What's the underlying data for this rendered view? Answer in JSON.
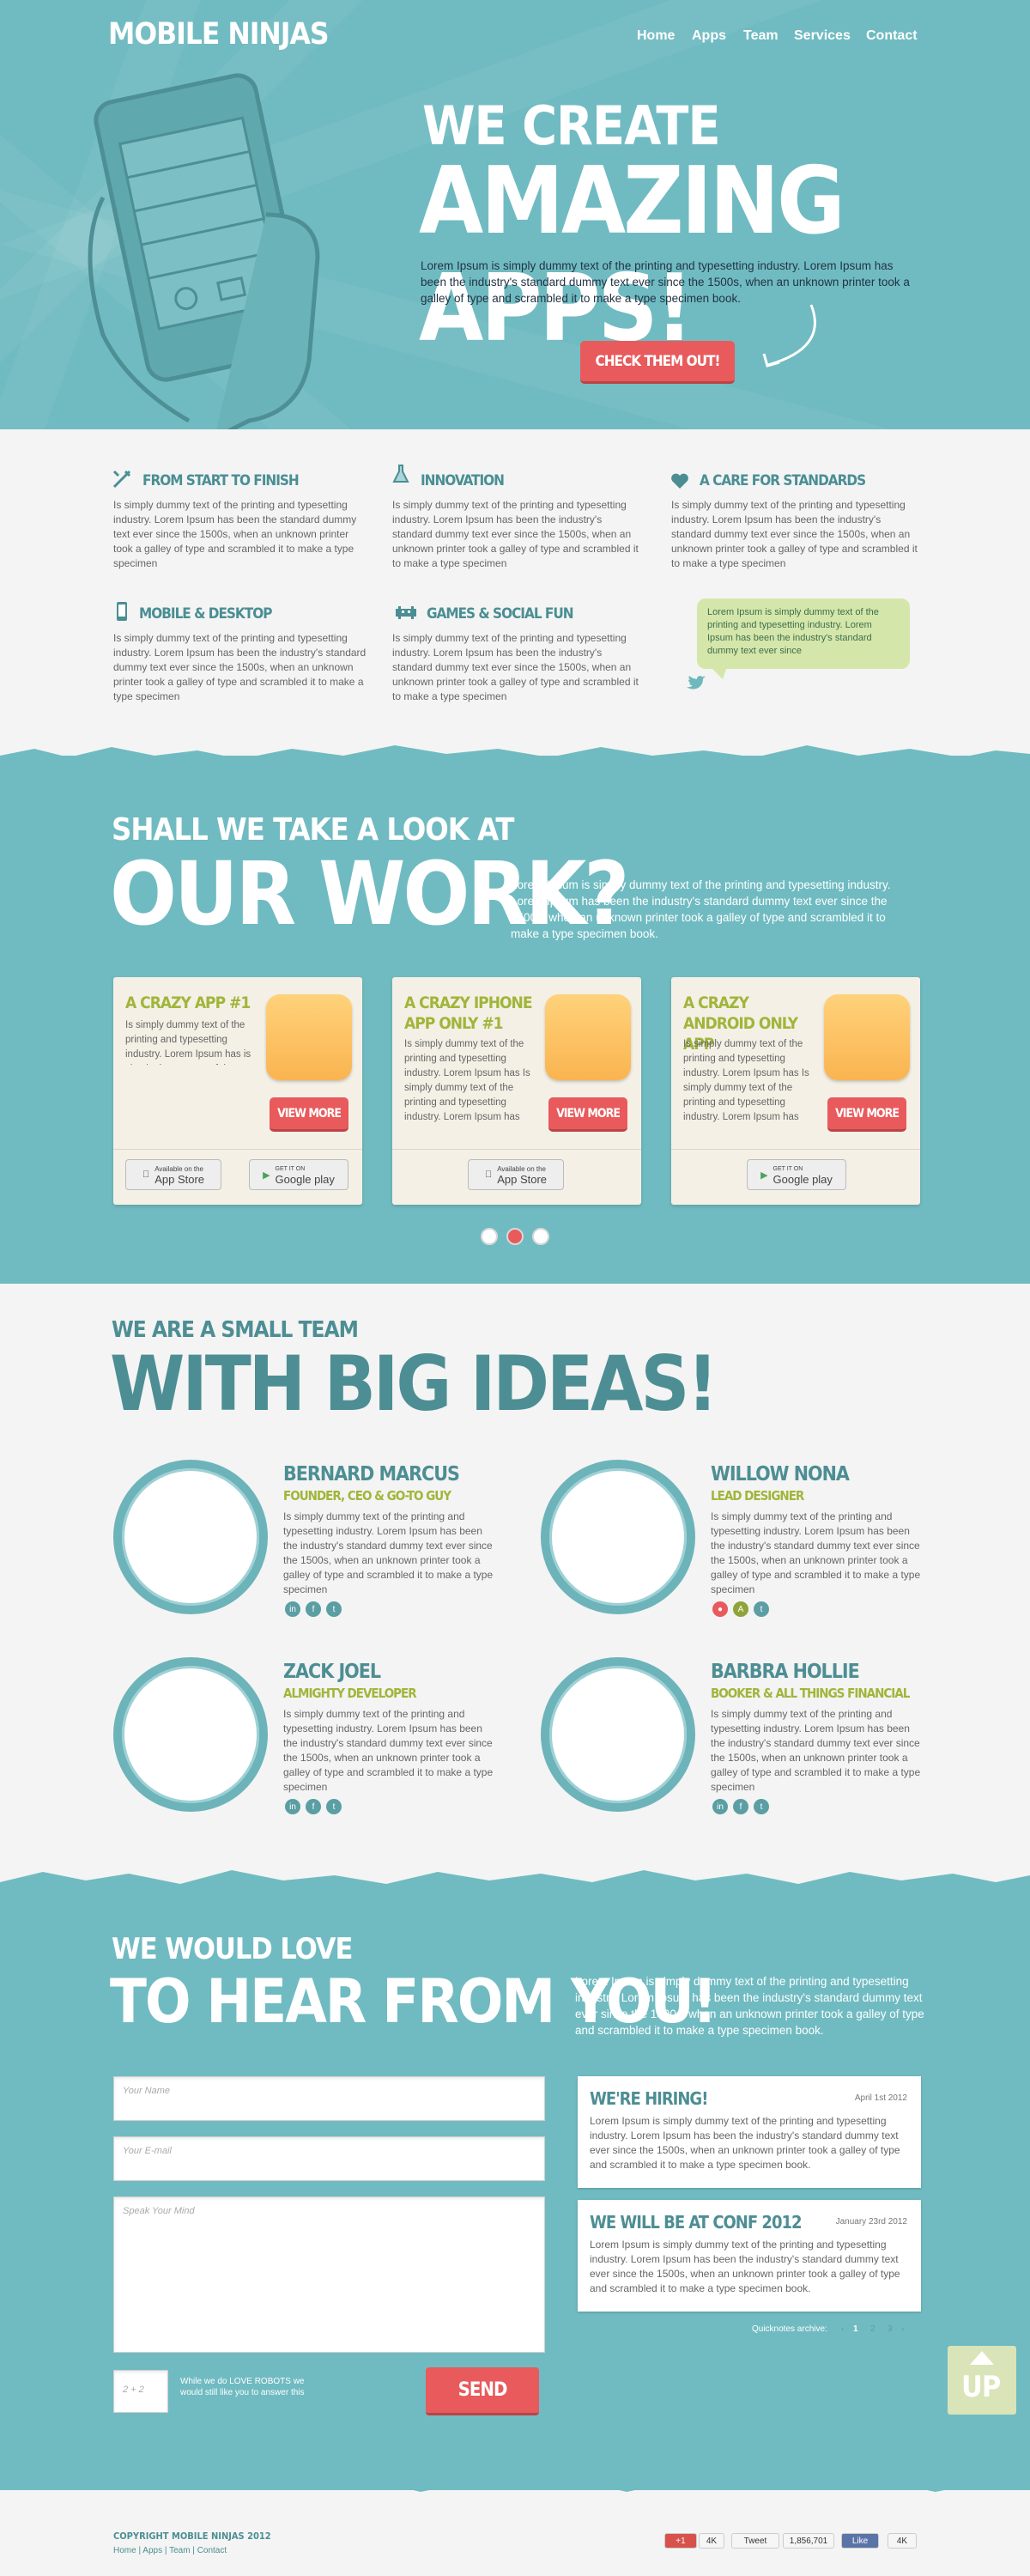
{
  "brand": {
    "name": "MOBILE NINJAS"
  },
  "nav": [
    "Home",
    "Apps",
    "Team",
    "Services",
    "Contact"
  ],
  "hero": {
    "line1": "WE CREATE",
    "line2": "AMAZING APPS!",
    "text": "Lorem Ipsum is simply dummy text of the printing and typesetting industry. Lorem Ipsum has been the industry's standard dummy text ever since the 1500s, when an unknown printer took a galley of type and scrambled it to make a type specimen book.",
    "cta": "CHECK THEM OUT!"
  },
  "features": [
    {
      "title": "FROM START TO FINISH",
      "icon": "tools-icon",
      "text": "Is simply dummy text of the printing and typesetting industry. Lorem Ipsum has been the standard dummy text ever since the 1500s, when an unknown printer took a galley of type and scrambled it to make a type specimen"
    },
    {
      "title": "INNOVATION",
      "icon": "flask-icon",
      "text": "Is simply dummy text of the printing and typesetting industry. Lorem Ipsum has been the industry's standard dummy text ever since the 1500s, when an unknown printer took a galley of type and scrambled it to make a type specimen"
    },
    {
      "title": "A CARE FOR STANDARDS",
      "icon": "heart-icon",
      "text": "Is simply dummy text of the printing and typesetting industry. Lorem Ipsum has been the industry's standard dummy text ever since the 1500s, when an unknown printer took a galley of type and scrambled it to make a type specimen"
    },
    {
      "title": "MOBILE & DESKTOP",
      "icon": "phone-icon",
      "text": "Is simply dummy text of the printing and typesetting industry. Lorem Ipsum has been the industry's standard dummy text ever since the 1500s, when an unknown printer took a galley of type and scrambled it to make a type specimen"
    },
    {
      "title": "GAMES & SOCIAL FUN",
      "icon": "invader-icon",
      "text": "Is simply dummy text of the printing and typesetting industry. Lorem Ipsum has been the industry's standard dummy text ever since the 1500s, when an unknown printer took a galley of type and scrambled it to make a type specimen"
    }
  ],
  "tweet": {
    "text": "Lorem Ipsum is simply dummy text of the printing and typesetting industry. Lorem Ipsum has been the industry's standard dummy text ever since"
  },
  "work": {
    "pre": "SHALL WE TAKE A LOOK AT",
    "title": "OUR WORK?",
    "text": "Lorem Ipsum is simply dummy text of the printing and typesetting industry. Lorem Ipsum has been the industry's standard dummy text ever since the 1500s, when an unknown printer took a galley of type and scrambled it to make a type specimen book.",
    "cards": [
      {
        "title": "A CRAZY APP #1",
        "text": "Is simply dummy text of the printing and typesetting industry. Lorem Ipsum has is simply dummy text of the",
        "button": "VIEW MORE"
      },
      {
        "title": "A CRAZY IPHONE APP ONLY #1",
        "text": "Is simply dummy text of the printing and typesetting industry. Lorem Ipsum has Is simply dummy text of the printing and typesetting industry. Lorem Ipsum has",
        "button": "VIEW MORE"
      },
      {
        "title": "A CRAZY ANDROID ONLY APP",
        "text": "Is simply dummy text of the printing and typesetting industry. Lorem Ipsum has Is simply dummy text of the printing and typesetting industry. Lorem Ipsum has",
        "button": "VIEW MORE"
      }
    ],
    "appstore": {
      "small": "Available on the",
      "big": "App Store"
    },
    "googleplay": {
      "small": "GET IT ON",
      "big": "Google play"
    }
  },
  "team": {
    "pre": "WE ARE A SMALL TEAM",
    "title": "WITH BIG IDEAS!",
    "members": [
      {
        "name": "BERNARD MARCUS",
        "role": "FOUNDER, CEO & GO-TO GUY",
        "text": "Is simply dummy text of the printing and typesetting industry. Lorem Ipsum has been the industry's standard dummy text ever since the 1500s, when an unknown printer took a galley of type and scrambled it to make a type specimen"
      },
      {
        "name": "WILLOW NONA",
        "role": "LEAD DESIGNER",
        "text": "Is simply dummy text of the printing and typesetting industry. Lorem Ipsum has been the industry's standard dummy text ever since the 1500s, when an unknown printer took a galley of type and scrambled it to make a type specimen"
      },
      {
        "name": "ZACK JOEL",
        "role": "ALMIGHTY DEVELOPER",
        "text": "Is simply dummy text of the printing and typesetting industry. Lorem Ipsum has been the industry's standard dummy text ever since the 1500s, when an unknown printer took a galley of type and scrambled it to make a type specimen"
      },
      {
        "name": "BARBRA HOLLIE",
        "role": "BOOKER & ALL THINGS FINANCIAL",
        "text": "Is simply dummy text of the printing and typesetting industry. Lorem Ipsum has been the industry's standard dummy text ever since the 1500s, when an unknown printer took a galley of type and scrambled it to make a type specimen"
      }
    ]
  },
  "contact": {
    "pre": "WE WOULD LOVE",
    "title": "TO HEAR FROM YOU!",
    "text": "Lorem Ipsum is simply dummy text of the printing and typesetting industry. Lorem Ipsum has been the industry's standard dummy text ever since the 1500s, when an unknown printer took a galley of type and scrambled it to make a type specimen book.",
    "name_placeholder": "Your Name",
    "email_placeholder": "Your E-mail",
    "message_placeholder": "Speak Your Mind",
    "captcha": "2 + 2",
    "captcha_note": "While we do LOVE ROBOTS we would still like you to answer this",
    "send": "SEND"
  },
  "news": [
    {
      "title": "WE'RE HIRING!",
      "date": "April 1st 2012",
      "text": "Lorem Ipsum is simply dummy text of the printing and typesetting industry. Lorem Ipsum has been the industry's standard dummy text ever since the 1500s, when an unknown printer took a galley of type and scrambled it to make a type specimen book."
    },
    {
      "title": "WE WILL BE AT CONF 2012",
      "date": "January 23rd 2012",
      "text": "Lorem Ipsum is simply dummy text of the printing and typesetting industry. Lorem Ipsum has been the industry's standard dummy text ever since the 1500s, when an unknown printer took a galley of type and scrambled it to make a type specimen book."
    }
  ],
  "archive": {
    "label": "Quicknotes archive:",
    "pages": [
      "1",
      "2",
      "3"
    ],
    "prev": "‹",
    "next": "›"
  },
  "up": "UP",
  "footer": {
    "copyright": "Copyright Mobile Ninjas 2012",
    "links": [
      "Home",
      "Apps",
      "Team",
      "Contact"
    ],
    "gplus": "+1",
    "gplus_count": "4K",
    "tweet": "Tweet",
    "tweet_count": "1,856,701",
    "like": "Like",
    "like_count": "4K"
  },
  "colors": {
    "teal": "#70bbc1",
    "red": "#e85a5c",
    "green": "#a1b53a",
    "dark_teal": "#4d8e94"
  }
}
